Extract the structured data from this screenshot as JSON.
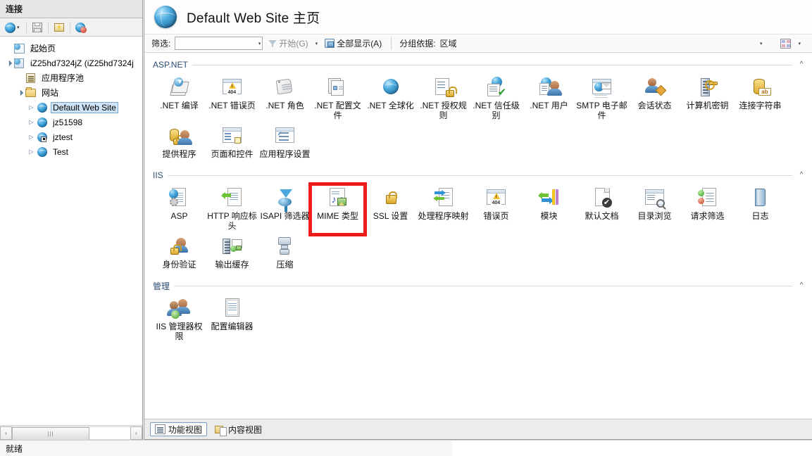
{
  "sidebar": {
    "header": "连接",
    "toolbar": [
      {
        "name": "connect-button",
        "icon": "globe-connect-icon",
        "has_caret": true
      },
      {
        "name": "save-connections-button",
        "icon": "floppy-disk-icon",
        "has_caret": false
      },
      {
        "name": "start-button",
        "icon": "start-task-icon",
        "has_caret": false
      },
      {
        "name": "stop-button",
        "icon": "stop-connection-icon",
        "has_caret": false
      }
    ],
    "tree": [
      {
        "label": "起始页",
        "icon": "start-page-icon",
        "depth": 0,
        "expander": "",
        "selected": false
      },
      {
        "label": "iZ25hd7324jZ (iZ25hd7324j",
        "icon": "server-icon",
        "depth": 0,
        "expander": "▲",
        "selected": false
      },
      {
        "label": "应用程序池",
        "icon": "app-pool-icon",
        "depth": 1,
        "expander": "",
        "selected": false
      },
      {
        "label": "网站",
        "icon": "sites-folder-icon",
        "depth": 1,
        "expander": "▲",
        "selected": false
      },
      {
        "label": "Default Web Site",
        "icon": "web-site-icon",
        "depth": 2,
        "expander": "▷",
        "selected": true
      },
      {
        "label": "jz51598",
        "icon": "web-site-icon",
        "depth": 2,
        "expander": "▷",
        "selected": false
      },
      {
        "label": "jztest",
        "icon": "web-site-stopped-icon",
        "depth": 2,
        "expander": "▷",
        "selected": false
      },
      {
        "label": "Test",
        "icon": "web-site-icon",
        "depth": 2,
        "expander": "▷",
        "selected": false
      }
    ],
    "scrollbar": {
      "left_arrow": "‹",
      "right_arrow": "›",
      "thumb_grip": "|||"
    }
  },
  "main": {
    "title": "Default Web Site 主页",
    "title_icon": "web-site-globe-icon",
    "filter": {
      "label": "筛选:",
      "value": "",
      "placeholder": "",
      "go_label": "开始(G)",
      "show_all_label": "全部显示(A)",
      "group_by_label": "分组依据:",
      "group_by_value": "区域",
      "caret": "▾"
    },
    "sections": [
      {
        "name": "ASP.NET",
        "chevron": "^",
        "tiles": [
          {
            "label": ".NET 编译",
            "icon": "net-compilation-icon"
          },
          {
            "label": ".NET 错误页",
            "icon": "net-error-pages-icon"
          },
          {
            "label": ".NET 角色",
            "icon": "net-roles-icon"
          },
          {
            "label": ".NET 配置文件",
            "icon": "net-profile-icon"
          },
          {
            "label": ".NET 全球化",
            "icon": "net-globalization-icon"
          },
          {
            "label": ".NET 授权规则",
            "icon": "net-authorization-rules-icon"
          },
          {
            "label": ".NET 信任级别",
            "icon": "net-trust-levels-icon"
          },
          {
            "label": ".NET 用户",
            "icon": "net-users-icon"
          },
          {
            "label": "SMTP 电子邮件",
            "icon": "smtp-email-icon"
          },
          {
            "label": "会话状态",
            "icon": "session-state-icon"
          },
          {
            "label": "计算机密钥",
            "icon": "machine-key-icon"
          },
          {
            "label": "连接字符串",
            "icon": "connection-strings-icon"
          },
          {
            "label": "提供程序",
            "icon": "providers-icon"
          },
          {
            "label": "页面和控件",
            "icon": "pages-and-controls-icon"
          },
          {
            "label": "应用程序设置",
            "icon": "application-settings-icon"
          }
        ]
      },
      {
        "name": "IIS",
        "chevron": "^",
        "tiles": [
          {
            "label": "ASP",
            "icon": "asp-icon"
          },
          {
            "label": "HTTP 响应标头",
            "icon": "http-response-headers-icon"
          },
          {
            "label": "ISAPI 筛选器",
            "icon": "isapi-filters-icon"
          },
          {
            "label": "MIME 类型",
            "icon": "mime-types-icon",
            "highlighted": true
          },
          {
            "label": "SSL 设置",
            "icon": "ssl-settings-icon"
          },
          {
            "label": "处理程序映射",
            "icon": "handler-mappings-icon"
          },
          {
            "label": "错误页",
            "icon": "error-pages-icon"
          },
          {
            "label": "模块",
            "icon": "modules-icon"
          },
          {
            "label": "默认文档",
            "icon": "default-document-icon"
          },
          {
            "label": "目录浏览",
            "icon": "directory-browsing-icon"
          },
          {
            "label": "请求筛选",
            "icon": "request-filtering-icon"
          },
          {
            "label": "日志",
            "icon": "logging-icon"
          },
          {
            "label": "身份验证",
            "icon": "authentication-icon"
          },
          {
            "label": "输出缓存",
            "icon": "output-caching-icon"
          },
          {
            "label": "压缩",
            "icon": "compression-icon"
          }
        ]
      },
      {
        "name": "管理",
        "chevron": "^",
        "tiles": [
          {
            "label": "IIS 管理器权限",
            "icon": "iis-manager-permissions-icon"
          },
          {
            "label": "配置编辑器",
            "icon": "configuration-editor-icon"
          }
        ]
      }
    ],
    "view_tabs": [
      {
        "label": "功能视图",
        "icon": "features-view-icon",
        "active": true
      },
      {
        "label": "内容视图",
        "icon": "content-view-icon",
        "active": false
      }
    ]
  },
  "statusbar": {
    "text": "就绪"
  },
  "colors": {
    "highlight_box": "#f01b1b",
    "section_header": "#2b4b74",
    "selection": "#cfe4f7",
    "chrome": "#e6e6e6"
  }
}
